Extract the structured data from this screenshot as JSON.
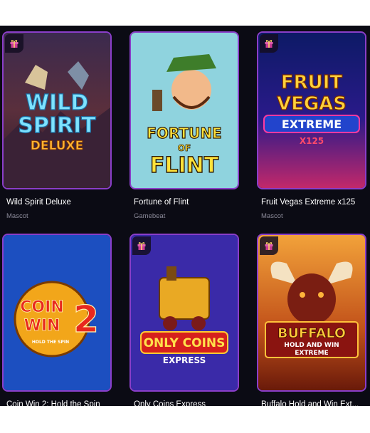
{
  "games": [
    {
      "title": "Wild Spirit Deluxe",
      "provider": "Mascot",
      "has_gift": true,
      "art": {
        "line1": "WILD",
        "line2": "SPIRIT",
        "line3": "DELUXE"
      }
    },
    {
      "title": "Fortune of Flint",
      "provider": "Gamebeat",
      "has_gift": false,
      "art": {
        "line1": "FORTUNE",
        "line2": "OF",
        "line3": "FLINT"
      }
    },
    {
      "title": "Fruit Vegas Extreme x125",
      "provider": "Mascot",
      "has_gift": true,
      "art": {
        "line1": "FRUIT",
        "line2": "VEGAS",
        "line3": "EXTREME",
        "line4": "X125"
      }
    },
    {
      "title": "Coin Win 2: Hold the Spin",
      "provider": "",
      "has_gift": false,
      "art": {
        "line1": "COIN",
        "line2": "WIN",
        "line3": "2",
        "line4": "HOLD THE SPIN"
      }
    },
    {
      "title": "Only Coins Express",
      "provider": "",
      "has_gift": true,
      "art": {
        "line1": "ONLY COINS",
        "line2": "EXPRESS"
      }
    },
    {
      "title": "Buffalo Hold and Win Ext...",
      "provider": "",
      "has_gift": true,
      "art": {
        "line1": "BUFFALO",
        "line2": "HOLD AND WIN",
        "line3": "EXTREME"
      }
    }
  ],
  "icons": {
    "gift": "gift-icon"
  },
  "colors": {
    "background": "#0b0b14",
    "card_border": "#8a3ec9",
    "provider_text": "#8b8a99"
  }
}
